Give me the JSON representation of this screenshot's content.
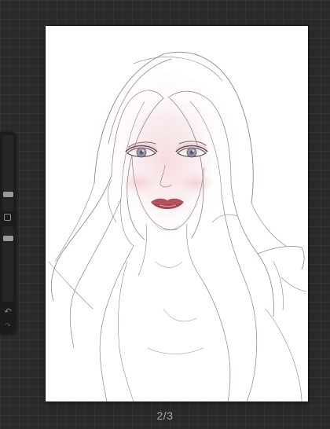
{
  "page_indicator": "2/3",
  "sidebar": {
    "brush_size": 0.2,
    "opacity": 0.86,
    "undo_icon": "undo-icon",
    "redo_icon": "redo-icon",
    "modify_icon": "square-icon"
  },
  "canvas": {
    "artwork": "portrait-sketch",
    "line_color": "#8f8582",
    "lip_color": "#b2505c",
    "iris_color": "#7f8ea6",
    "blush_color": "#f2c9cf"
  },
  "colors": {
    "background": "#2a2a2a",
    "sidebar": "#1c1c1c",
    "thumb": "#9a9a9a",
    "page_text": "#a8a8a8"
  }
}
